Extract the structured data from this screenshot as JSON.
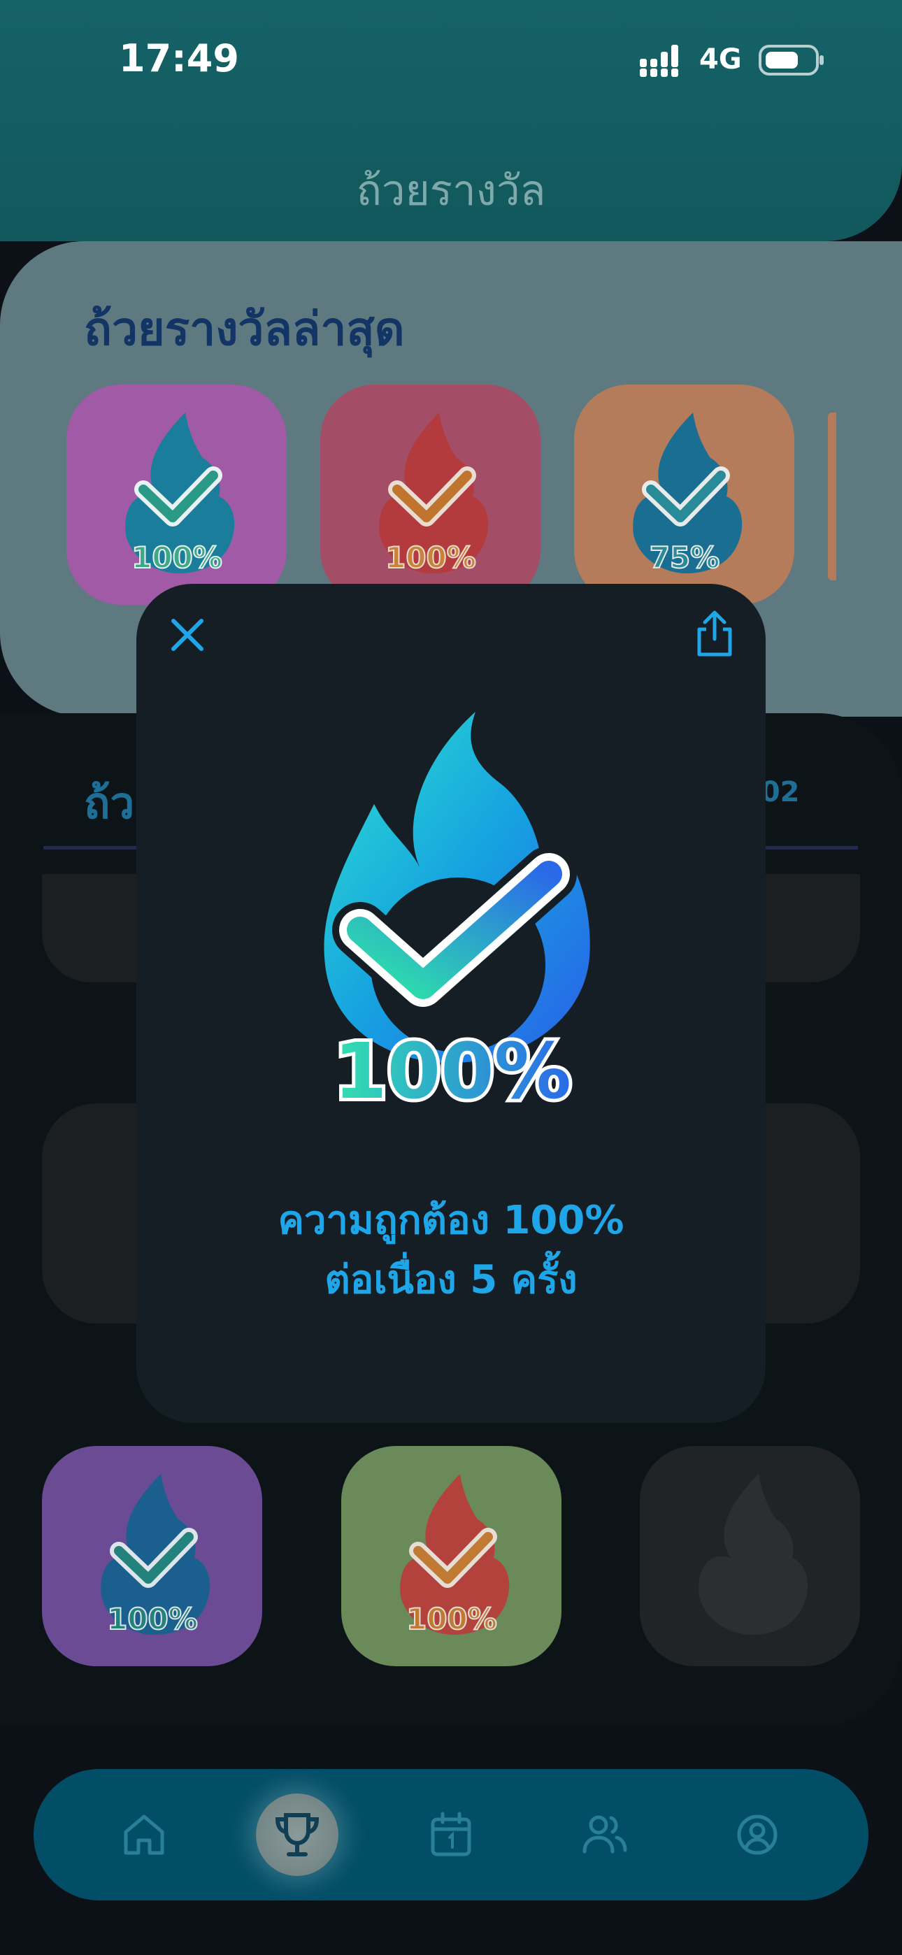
{
  "status_bar": {
    "time": "17:49",
    "network": "4G"
  },
  "page_title": "ถ้วยรางวัล",
  "recent": {
    "title": "ถ้วยรางวัลล่าสุด",
    "tiles": [
      {
        "percent": "100%",
        "bg": "#a05aa6",
        "flame": "blue"
      },
      {
        "percent": "100%",
        "bg": "#a34d67",
        "flame": "red"
      },
      {
        "percent": "75%",
        "bg": "#b47c5a",
        "flame": "blue"
      }
    ]
  },
  "all": {
    "title": "ถ้วยรางวัล",
    "count": "102",
    "bottom_row": [
      {
        "percent": "100%",
        "bg": "#6a4b94",
        "flame": "blue"
      },
      {
        "percent": "100%",
        "bg": "#6a8a5a",
        "flame": "red"
      },
      {
        "percent": "",
        "bg": "#202426",
        "flame": "locked"
      }
    ]
  },
  "modal": {
    "badge_percent": "100%",
    "line1": "ความถูกต้อง 100%",
    "line2": "ต่อเนื่อง 5 ครั้ง",
    "close_icon": "close-icon",
    "share_icon": "share-icon"
  },
  "nav": {
    "items": [
      "home-icon",
      "trophy-icon",
      "calendar-icon",
      "friends-icon",
      "profile-icon"
    ],
    "active": "trophy-icon"
  },
  "colors": {
    "accent": "#1fa6e8",
    "header": "#156266",
    "nav": "#034e67"
  }
}
